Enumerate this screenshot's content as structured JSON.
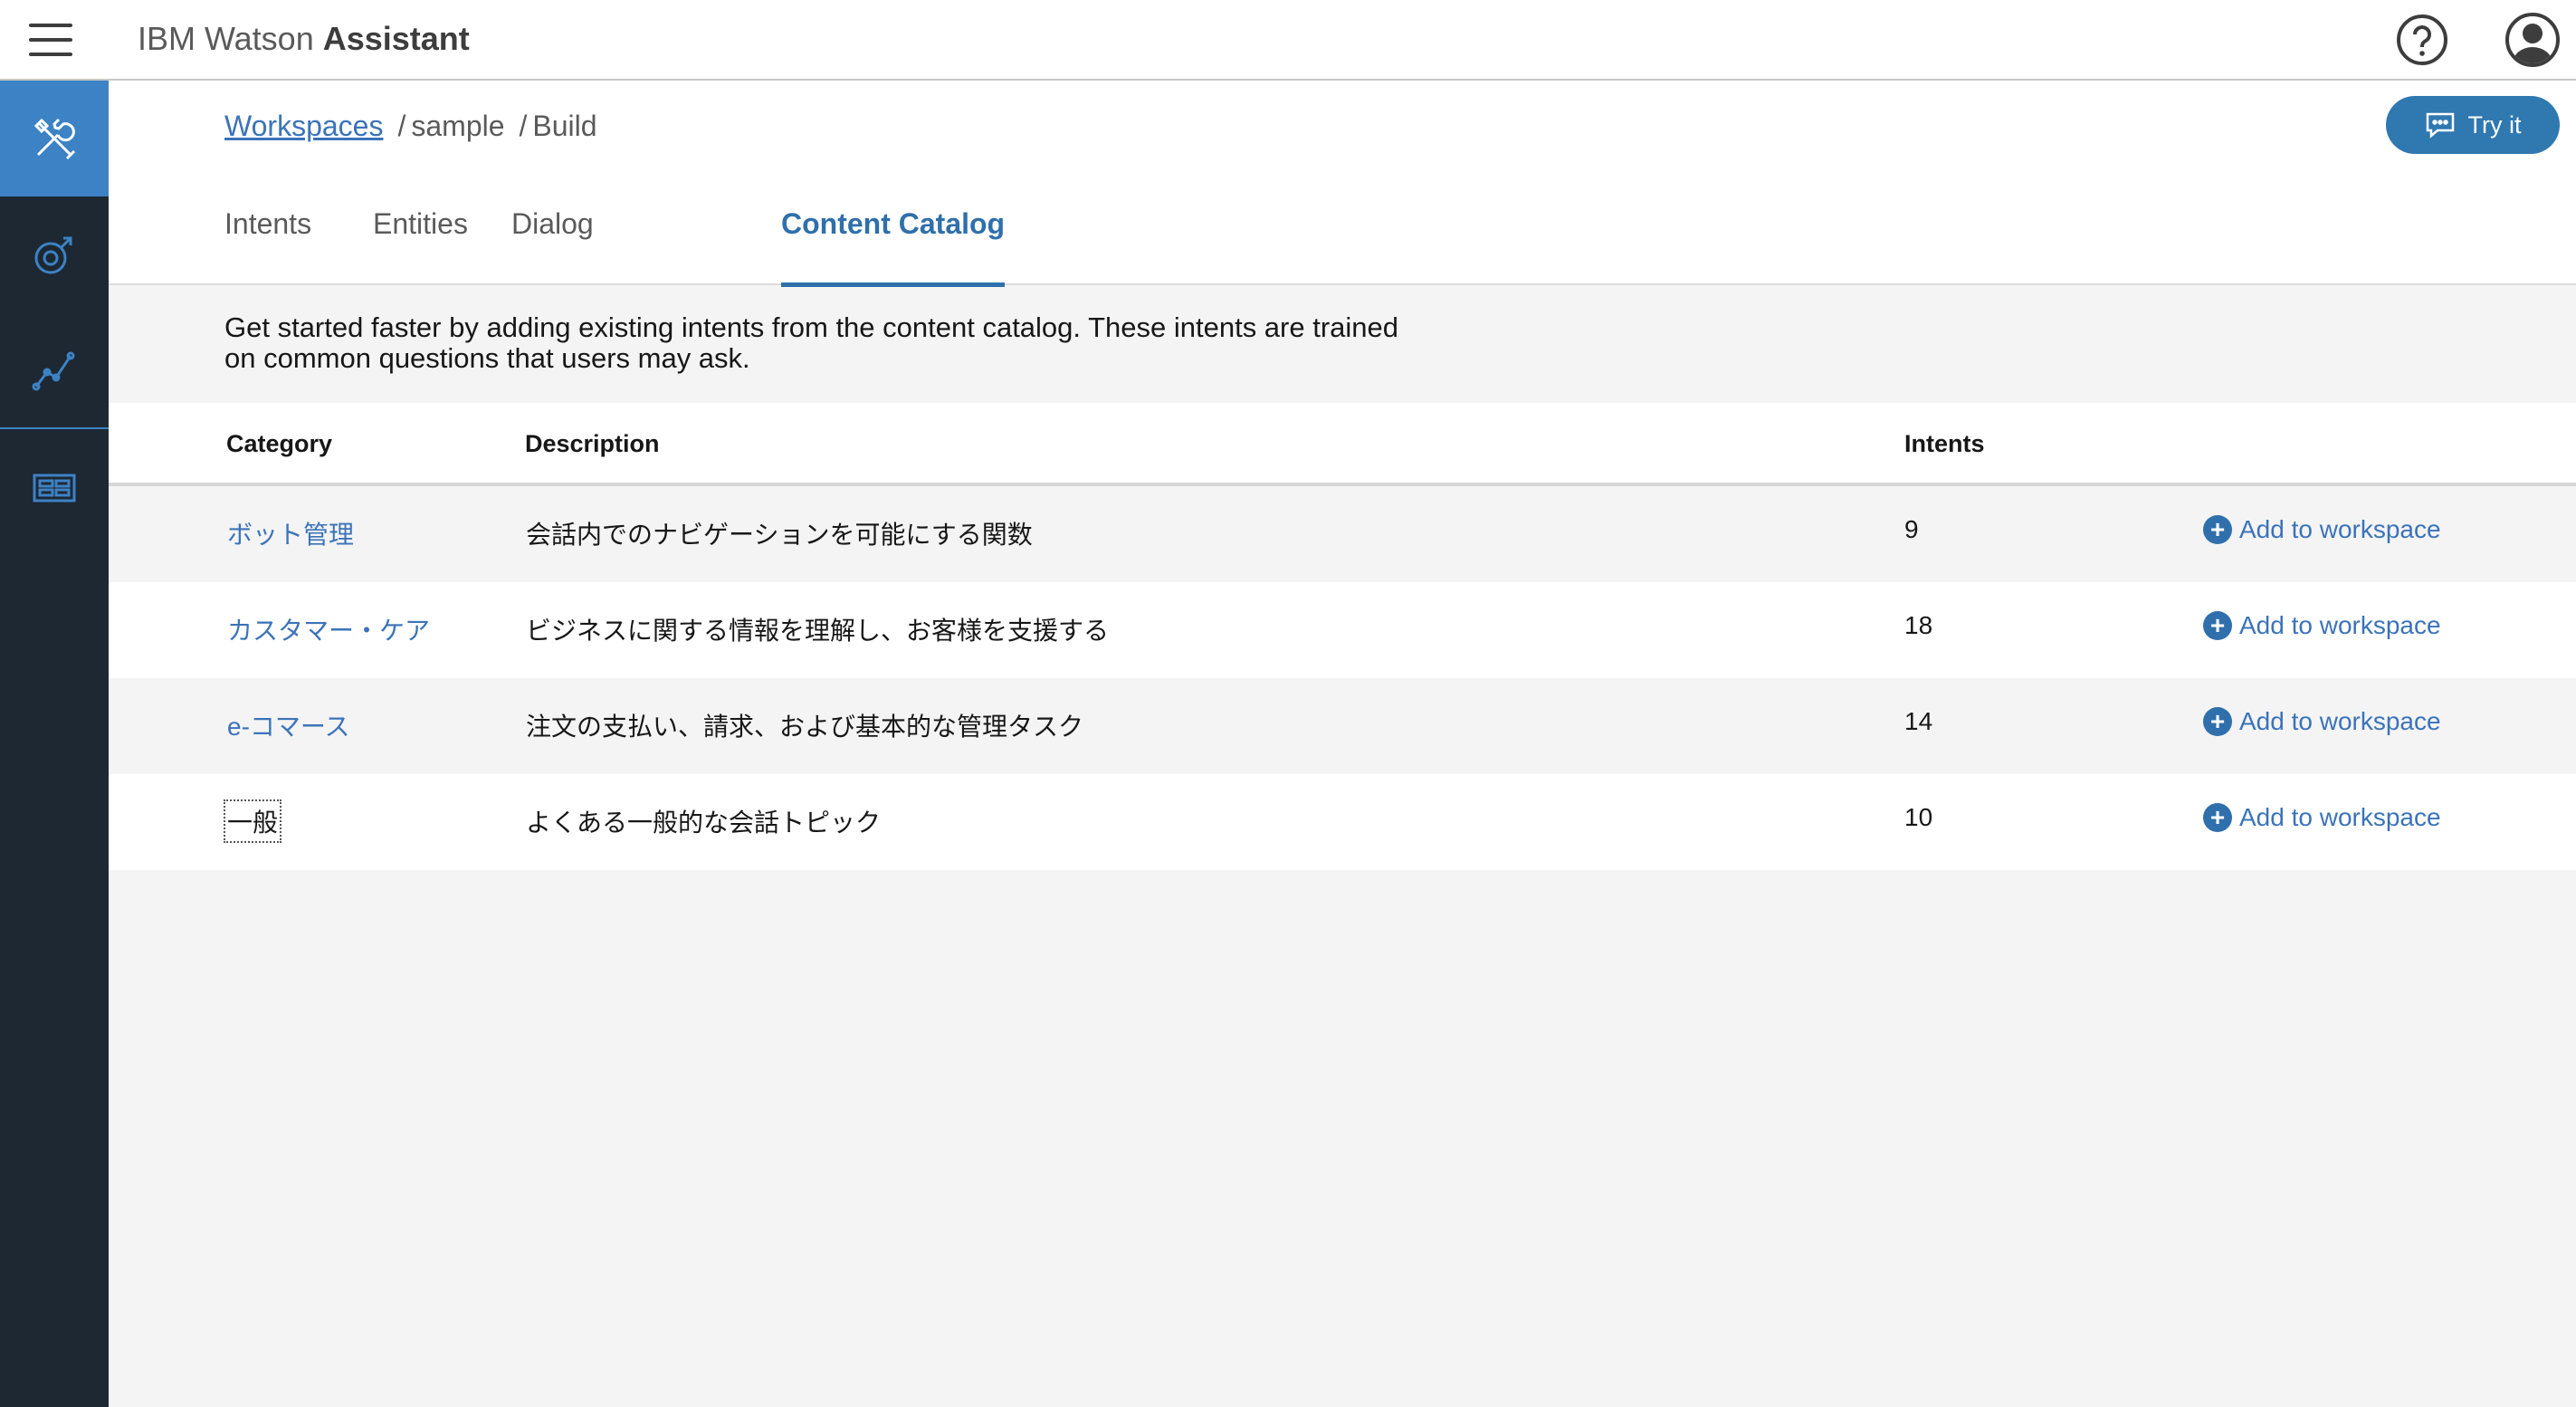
{
  "app": {
    "title_prefix": "IBM Watson ",
    "title_bold": "Assistant"
  },
  "header": {
    "breadcrumb": {
      "link": "Workspaces",
      "workspace": "sample",
      "section": "Build",
      "separator": "/"
    },
    "try_it_label": "Try it"
  },
  "tabs": [
    {
      "label": "Intents",
      "active": false
    },
    {
      "label": "Entities",
      "active": false
    },
    {
      "label": "Dialog",
      "active": false
    },
    {
      "label": "Content Catalog",
      "active": true
    }
  ],
  "intro": "Get started faster by adding existing intents from the content catalog. These intents are trained on common questions that users may ask.",
  "table": {
    "columns": [
      "Category",
      "Description",
      "Intents"
    ],
    "rows": [
      {
        "category": "ボット管理",
        "description": "会話内でのナビゲーションを可能にする関数",
        "intents": "9",
        "action": "Add to workspace"
      },
      {
        "category": "カスタマー・ケア",
        "description": "ビジネスに関する情報を理解し、お客様を支援する",
        "intents": "18",
        "action": "Add to workspace"
      },
      {
        "category": "e-コマース",
        "description": "注文の支払い、請求、および基本的な管理タスク",
        "intents": "14",
        "action": "Add to workspace"
      },
      {
        "category": "一般",
        "description": "よくある一般的な会話トピック",
        "intents": "10",
        "action": "Add to workspace"
      }
    ]
  },
  "sidebar": {
    "items": [
      {
        "icon": "build-tools-icon",
        "active": true
      },
      {
        "icon": "deploy-icon",
        "active": false
      },
      {
        "icon": "analytics-icon",
        "active": false
      },
      {
        "icon": "catalog-icon",
        "active": false
      }
    ]
  },
  "colors": {
    "accent": "#2f6fac",
    "sidebar": "#1d2833",
    "sidebar_active": "#3d82c4",
    "link": "#3b73b9"
  }
}
